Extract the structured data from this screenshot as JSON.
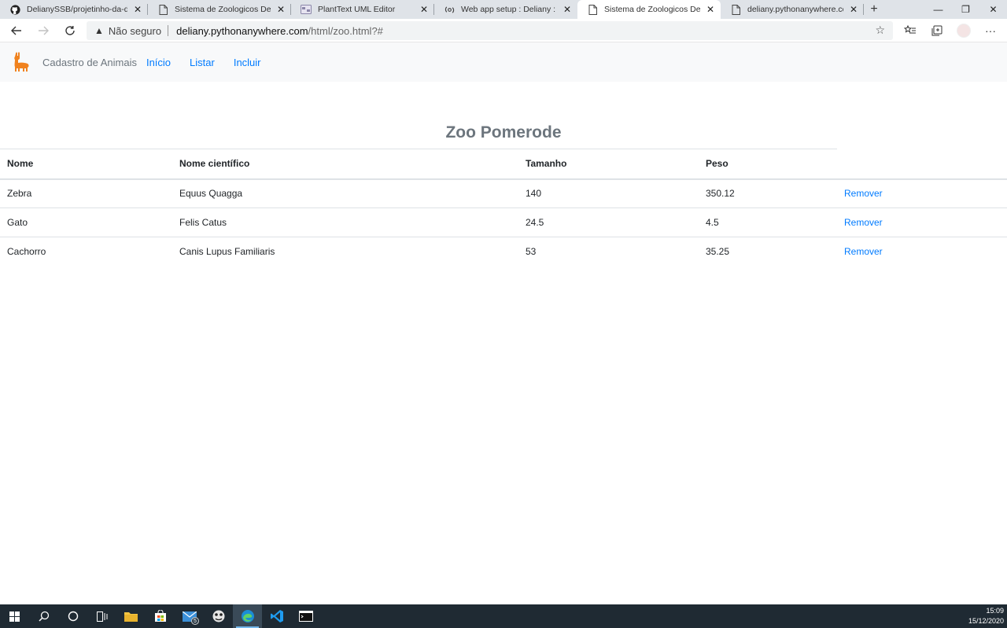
{
  "browser": {
    "tabs": [
      {
        "title": "DelianySSB/projetinho-da-deli: S",
        "icon": "github-icon",
        "active": false
      },
      {
        "title": "Sistema de Zoologicos Deliany",
        "icon": "page-icon",
        "active": false
      },
      {
        "title": "PlantText UML Editor",
        "icon": "planttext-icon",
        "active": false
      },
      {
        "title": "Web app setup : Deliany : Python",
        "icon": "pythonanywhere-icon",
        "active": false
      },
      {
        "title": "Sistema de Zoologicos Deliany",
        "icon": "page-icon",
        "active": true
      },
      {
        "title": "deliany.pythonanywhere.com/lis",
        "icon": "page-icon",
        "active": false
      }
    ],
    "security_label": "Não seguro",
    "url_host": "deliany.pythonanywhere.com",
    "url_path": "/html/zoo.html?#"
  },
  "navbar": {
    "brand": "Cadastro de Animais",
    "links": [
      "Início",
      "Listar",
      "Incluir"
    ]
  },
  "zoo": {
    "title": "Zoo Pomerode",
    "columns": [
      "Nome",
      "Nome científico",
      "Tamanho",
      "Peso"
    ],
    "rows": [
      {
        "nome": "Zebra",
        "cientifico": "Equus Quagga",
        "tamanho": "140",
        "peso": "350.12",
        "acao": "Remover"
      },
      {
        "nome": "Gato",
        "cientifico": "Felis Catus",
        "tamanho": "24.5",
        "peso": "4.5",
        "acao": "Remover"
      },
      {
        "nome": "Cachorro",
        "cientifico": "Canis Lupus Familiaris",
        "tamanho": "53",
        "peso": "35.25",
        "acao": "Remover"
      }
    ]
  },
  "taskbar": {
    "mail_badge": "5",
    "time": "15:09",
    "date": "15/12/2020"
  },
  "colors": {
    "link": "#007bff",
    "navbar_bg": "#f8f9fa",
    "title": "#6c757d",
    "taskbar_bg": "#1f2a33"
  }
}
